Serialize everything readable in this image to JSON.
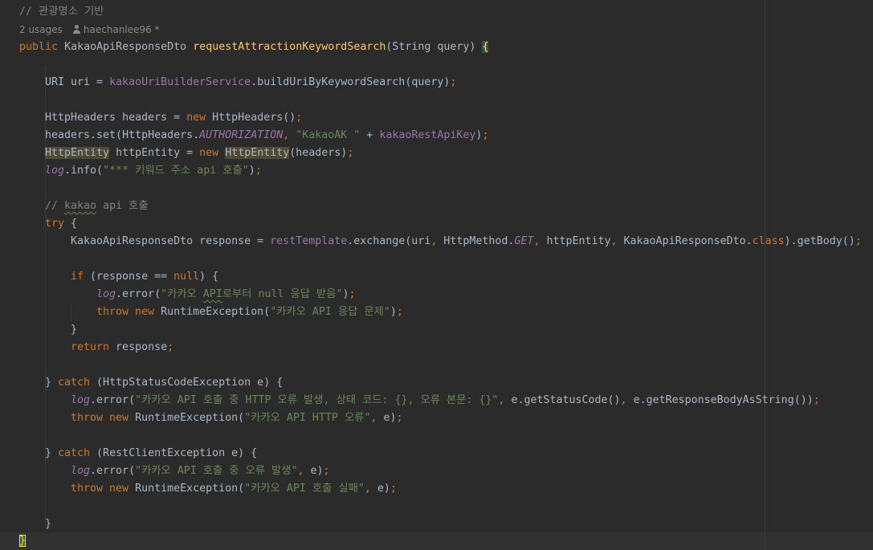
{
  "code": {
    "comment_header": "// 관광명소 기반",
    "hint": {
      "usages": "2 usages",
      "author": "haechanlee96 *"
    },
    "l_sig": {
      "public": "public",
      "rtype": "KakaoApiResponseDto",
      "method": "requestAttractionKeywordSearch",
      "params": "(String query) ",
      "brace": "{"
    },
    "l_uri": {
      "a": "URI uri = ",
      "svc": "kakaoUriBuilderService",
      "b": ".buildUriByKeywordSearch(query)",
      "semi": ";"
    },
    "l_headers": {
      "a": "HttpHeaders headers = ",
      "new": "new",
      "b": " HttpHeaders()",
      "semi": ";"
    },
    "l_set": {
      "a": "headers.set(HttpHeaders.",
      "auth": "AUTHORIZATION",
      "comma": ", ",
      "str": "\"KakaoAK \"",
      "b": " + ",
      "key": "kakaoRestApiKey",
      "c": ")",
      "semi": ";"
    },
    "l_entity": {
      "t1": "HttpEntity",
      "a": " httpEntity = ",
      "new": "new",
      "sp": " ",
      "t2": "HttpEntity",
      "b": "(headers)",
      "semi": ";"
    },
    "l_info": {
      "log": "log",
      "a": ".info(",
      "str": "\"*** 키워드 주소 api 호출\"",
      "b": ")",
      "semi": ";"
    },
    "l_cmt2": {
      "a": "// ",
      "kakao": "kakao",
      "b": " api 호출"
    },
    "l_try": {
      "kw": "try",
      "b": " {"
    },
    "l_resp": {
      "a": "KakaoApiResponseDto response = ",
      "rt": "restTemplate",
      "b": ".exchange(uri",
      "c1": ", ",
      "b2": "HttpMethod.",
      "get": "GET",
      "c2": ", ",
      "b3": "httpEntity",
      "c3": ", ",
      "b4": "KakaoApiResponseDto.",
      "cls": "class",
      "b5": ").getBody()",
      "semi": ";"
    },
    "l_if": {
      "kw": "if",
      "a": " (response == ",
      "null": "null",
      "b": ") {"
    },
    "l_err1": {
      "log": "log",
      "a": ".error(",
      "s1": "\"카카오 ",
      "api": "API",
      "s2": "로부터 null 응답 받음\"",
      "b": ")",
      "semi": ";"
    },
    "l_throw1": {
      "throw": "throw",
      "sp": " ",
      "new": "new",
      "a": " RuntimeException(",
      "str": "\"카카오 API 응답 문제\"",
      "b": ")",
      "semi": ";"
    },
    "l_close1": {
      "a": "}"
    },
    "l_return": {
      "kw": "return",
      "a": " response",
      "semi": ";"
    },
    "l_catch1": {
      "a": "} ",
      "kw": "catch",
      "b": " (HttpStatusCodeException e) {"
    },
    "l_err2": {
      "log": "log",
      "a": ".error(",
      "str": "\"카카오 API 호출 중 HTTP 오류 발생, 상태 코드: {}, 오류 본문: {}\"",
      "c1": ", ",
      "b": "e.getStatusCode()",
      "c2": ", ",
      "c": "e.getResponseBodyAsString())",
      "semi": ";"
    },
    "l_throw2": {
      "throw": "throw",
      "sp": " ",
      "new": "new",
      "a": " RuntimeException(",
      "str": "\"카카오 API HTTP 오류\"",
      "c": ", ",
      "b": "e)",
      "semi": ";"
    },
    "l_catch2": {
      "a": "} ",
      "kw": "catch",
      "b": " (RestClientException e) {"
    },
    "l_err3": {
      "log": "log",
      "a": ".error(",
      "str": "\"카카오 API 호출 중 오류 발생\"",
      "c": ", ",
      "b": "e)",
      "semi": ";"
    },
    "l_throw3": {
      "throw": "throw",
      "sp": " ",
      "new": "new",
      "a": " RuntimeException(",
      "str": "\"카카오 API 호출 실패\"",
      "c": ", ",
      "b": "e)",
      "semi": ";"
    },
    "l_close2": {
      "a": "}"
    },
    "l_close3": {
      "a": "}"
    }
  },
  "colors": {
    "background": "#2b2b2b",
    "keyword": "#cc7832",
    "string": "#6a8759",
    "field": "#9876aa",
    "method": "#ffc66d",
    "comment": "#808080",
    "text": "#a9b7c6"
  }
}
